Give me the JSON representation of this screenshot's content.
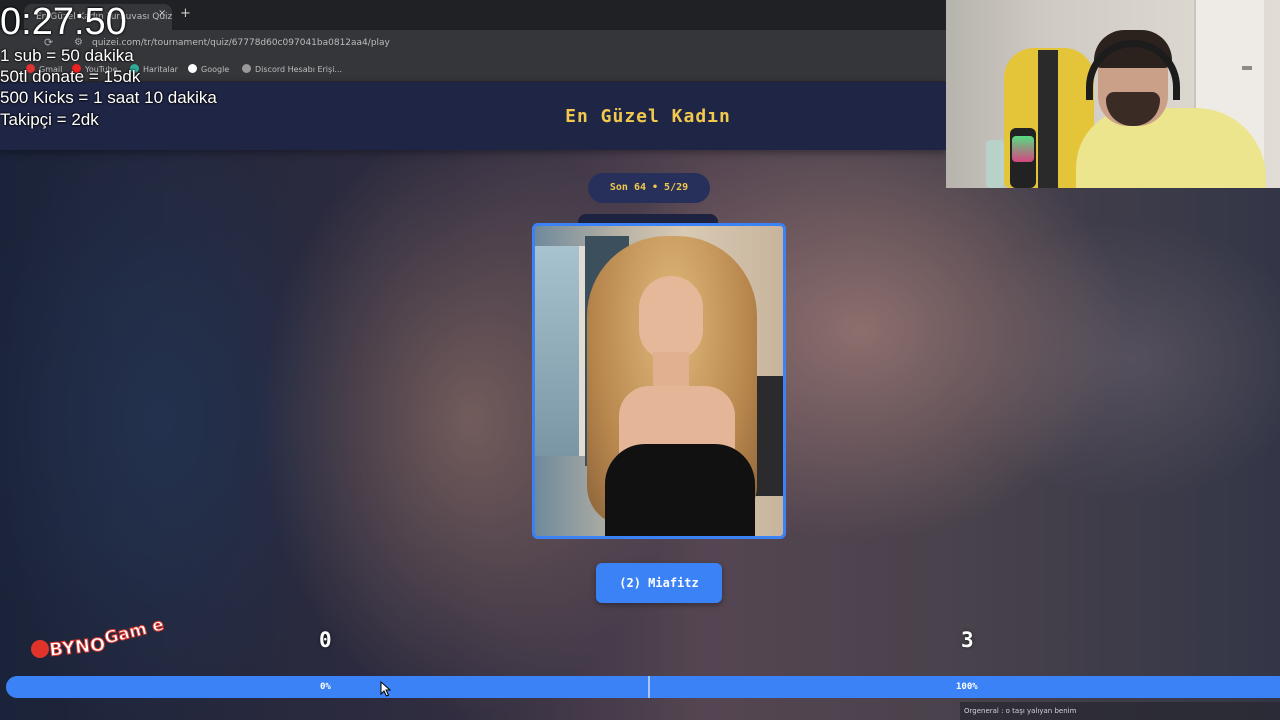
{
  "stream": {
    "timer": "0:27:50",
    "rules": [
      "1 sub = 50 dakika",
      "50tl donate =  15dk",
      "500 Kicks  = 1 saat 10 dakika",
      "Takipçi = 2dk"
    ]
  },
  "browser": {
    "tab_title": "En Güzel Kadın Turnuvası Quizei Kör Sı",
    "new_tab_symbol": "+",
    "close_symbol": "×",
    "url": "quizei.com/tr/tournament/quiz/67778d60c097041ba0812aa4/play",
    "bookmarks": [
      "Gmail",
      "YouTube",
      "Haritalar",
      "Google",
      "Discord Hesabı Erişi..."
    ]
  },
  "page": {
    "title": "En Güzel Kadın",
    "round_badge": "Son 64 • 5/29",
    "choice_button": "(2) Miafitz"
  },
  "scores": {
    "left": "0",
    "right": "3"
  },
  "progress": {
    "left_label": "0%",
    "right_label": "100%",
    "left_fraction": 0.0,
    "right_fraction": 1.0
  },
  "logo": {
    "text_main": "BYNO",
    "text_accent": "Gam e"
  },
  "chat": {
    "line": "Orgeneral : o taşı yalıyan benim"
  },
  "colors": {
    "accent": "#3b82f6",
    "title": "#f2c94c",
    "header_bg": "#1f2544"
  }
}
